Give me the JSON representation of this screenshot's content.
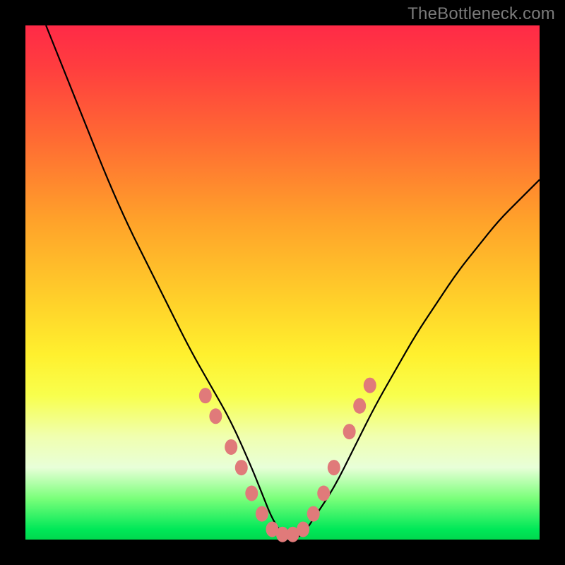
{
  "watermark": "TheBottleneck.com",
  "chart_data": {
    "type": "line",
    "title": "",
    "xlabel": "",
    "ylabel": "",
    "xlim": [
      0,
      100
    ],
    "ylim": [
      0,
      100
    ],
    "grid": false,
    "legend": false,
    "series": [
      {
        "name": "bottleneck-curve",
        "x": [
          4,
          8,
          12,
          16,
          20,
          24,
          28,
          32,
          36,
          40,
          44,
          46,
          48,
          50,
          52,
          54,
          56,
          60,
          64,
          68,
          72,
          76,
          80,
          84,
          88,
          92,
          96,
          100
        ],
        "y": [
          100,
          90,
          80,
          70,
          61,
          53,
          45,
          37,
          30,
          23,
          14,
          9,
          4,
          1,
          0,
          1,
          4,
          10,
          18,
          26,
          33,
          40,
          46,
          52,
          57,
          62,
          66,
          70
        ]
      }
    ],
    "markers": [
      {
        "x": 35,
        "y": 28
      },
      {
        "x": 37,
        "y": 24
      },
      {
        "x": 40,
        "y": 18
      },
      {
        "x": 42,
        "y": 14
      },
      {
        "x": 44,
        "y": 9
      },
      {
        "x": 46,
        "y": 5
      },
      {
        "x": 48,
        "y": 2
      },
      {
        "x": 50,
        "y": 1
      },
      {
        "x": 52,
        "y": 1
      },
      {
        "x": 54,
        "y": 2
      },
      {
        "x": 56,
        "y": 5
      },
      {
        "x": 58,
        "y": 9
      },
      {
        "x": 60,
        "y": 14
      },
      {
        "x": 63,
        "y": 21
      },
      {
        "x": 65,
        "y": 26
      },
      {
        "x": 67,
        "y": 30
      }
    ],
    "gradient_stops": [
      {
        "pos": 0,
        "color": "#ff2a47"
      },
      {
        "pos": 22,
        "color": "#ff6a33"
      },
      {
        "pos": 54,
        "color": "#ffd22a"
      },
      {
        "pos": 72,
        "color": "#f8ff4d"
      },
      {
        "pos": 92,
        "color": "#7aff7a"
      },
      {
        "pos": 100,
        "color": "#00d84e"
      }
    ]
  }
}
